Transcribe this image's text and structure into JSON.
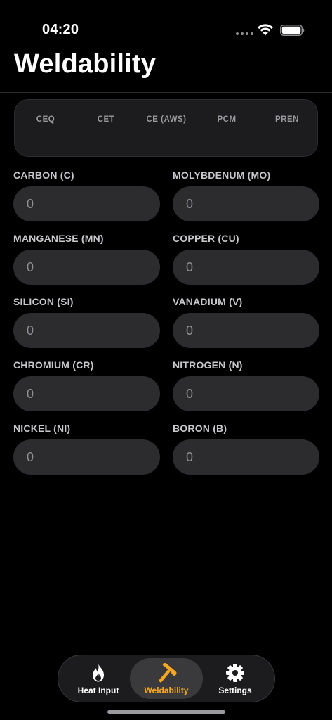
{
  "status_bar": {
    "time": "04:20"
  },
  "page": {
    "title": "Weldability"
  },
  "summary": {
    "metrics": [
      {
        "label": "CEQ",
        "value": "—"
      },
      {
        "label": "CET",
        "value": "—"
      },
      {
        "label": "CE (AWS)",
        "value": "—"
      },
      {
        "label": "PCM",
        "value": "—"
      },
      {
        "label": "PREN",
        "value": "—"
      }
    ]
  },
  "elements": [
    {
      "label": "CARBON (C)",
      "placeholder": "0"
    },
    {
      "label": "MOLYBDENUM (MO)",
      "placeholder": "0"
    },
    {
      "label": "MANGANESE (MN)",
      "placeholder": "0"
    },
    {
      "label": "COPPER (CU)",
      "placeholder": "0"
    },
    {
      "label": "SILICON (SI)",
      "placeholder": "0"
    },
    {
      "label": "VANADIUM (V)",
      "placeholder": "0"
    },
    {
      "label": "CHROMIUM (CR)",
      "placeholder": "0"
    },
    {
      "label": "NITROGEN (N)",
      "placeholder": "0"
    },
    {
      "label": "NICKEL (NI)",
      "placeholder": "0"
    },
    {
      "label": "BORON (B)",
      "placeholder": "0"
    }
  ],
  "tab_bar": {
    "tabs": [
      {
        "label": "Heat Input",
        "icon": "flame-icon",
        "active": false
      },
      {
        "label": "Weldability",
        "icon": "hammer-icon",
        "active": true
      },
      {
        "label": "Settings",
        "icon": "gear-icon",
        "active": false
      }
    ],
    "accent_color": "#f5a623"
  }
}
